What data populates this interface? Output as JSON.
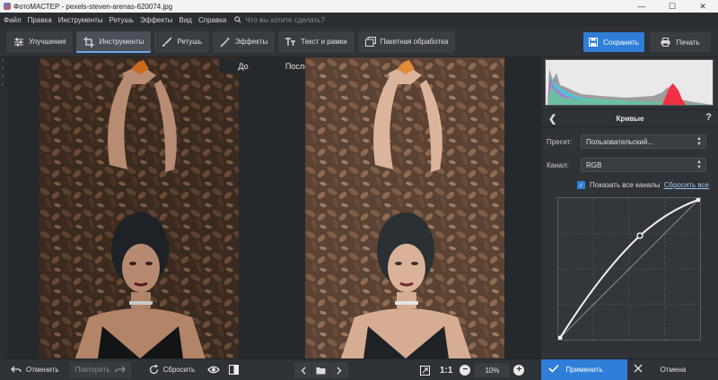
{
  "window": {
    "title": "ФотоМАСТЕР - pexels-steven-arenas-620074.jpg",
    "minimize_glyph": "—",
    "maximize_glyph": "☐",
    "close_glyph": "✕"
  },
  "menu": {
    "items": [
      "Файл",
      "Правка",
      "Инструменты",
      "Ретушь",
      "Эффекты",
      "Вид",
      "Справка"
    ],
    "search_placeholder": "Что вы хотите сделать?"
  },
  "toolbar": {
    "tabs": [
      {
        "label": "Улучшения",
        "icon": "sliders-icon",
        "active": false
      },
      {
        "label": "Инструменты",
        "icon": "crop-icon",
        "active": true
      },
      {
        "label": "Ретушь",
        "icon": "brush-icon",
        "active": false
      },
      {
        "label": "Эффекты",
        "icon": "magic-wand-icon",
        "active": false
      },
      {
        "label": "Текст и рамки",
        "icon": "text-icon",
        "active": false
      },
      {
        "label": "Пакетная обработка",
        "icon": "batch-icon",
        "active": false
      }
    ],
    "save_label": "Сохранить",
    "print_label": "Печать"
  },
  "canvas": {
    "before_label": "До",
    "after_label": "После"
  },
  "panel": {
    "title": "Кривые",
    "help_glyph": "?",
    "back_glyph": "❮",
    "preset_label": "Пресет:",
    "preset_value": "Пользовательский...",
    "channel_label": "Канал:",
    "channel_value": "RGB",
    "show_all_channels_label": "Показать все каналы",
    "show_all_channels_checked": true,
    "reset_all_label": "Сбросить все"
  },
  "bottom": {
    "undo_label": "Отменить",
    "redo_label": "Повторить",
    "reset_label": "Сбросить",
    "one_to_one_label": "1:1",
    "zoom_value": "10%",
    "apply_label": "Применить",
    "cancel_label": "Отмена"
  },
  "colors": {
    "accent": "#2f7ed8",
    "panel_bg": "#2f3236",
    "canvas_bg": "#26292c"
  }
}
